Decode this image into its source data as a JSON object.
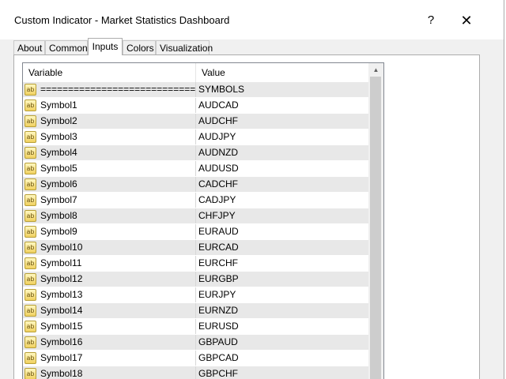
{
  "window": {
    "title": "Custom Indicator - Market Statistics Dashboard",
    "help_label": "?",
    "close_label": "✕"
  },
  "tabs": [
    {
      "label": "About"
    },
    {
      "label": "Common"
    },
    {
      "label": "Inputs",
      "active": true
    },
    {
      "label": "Colors"
    },
    {
      "label": "Visualization"
    }
  ],
  "grid": {
    "headers": {
      "variable": "Variable",
      "value": "Value"
    },
    "row_icon": "ab-string-icon",
    "icon_text": "ab",
    "rows": [
      {
        "variable": "================================",
        "value": "SYMBOLS"
      },
      {
        "variable": "Symbol1",
        "value": "AUDCAD"
      },
      {
        "variable": "Symbol2",
        "value": "AUDCHF"
      },
      {
        "variable": "Symbol3",
        "value": "AUDJPY"
      },
      {
        "variable": "Symbol4",
        "value": "AUDNZD"
      },
      {
        "variable": "Symbol5",
        "value": "AUDUSD"
      },
      {
        "variable": "Symbol6",
        "value": "CADCHF"
      },
      {
        "variable": "Symbol7",
        "value": "CADJPY"
      },
      {
        "variable": "Symbol8",
        "value": "CHFJPY"
      },
      {
        "variable": "Symbol9",
        "value": "EURAUD"
      },
      {
        "variable": "Symbol10",
        "value": "EURCAD"
      },
      {
        "variable": "Symbol11",
        "value": "EURCHF"
      },
      {
        "variable": "Symbol12",
        "value": "EURGBP"
      },
      {
        "variable": "Symbol13",
        "value": "EURJPY"
      },
      {
        "variable": "Symbol14",
        "value": "EURNZD"
      },
      {
        "variable": "Symbol15",
        "value": "EURUSD"
      },
      {
        "variable": "Symbol16",
        "value": "GBPAUD"
      },
      {
        "variable": "Symbol17",
        "value": "GBPCAD"
      },
      {
        "variable": "Symbol18",
        "value": "GBPCHF"
      }
    ]
  },
  "scrollbar": {
    "up_arrow_icon": "chevron-up-icon",
    "up_arrow_glyph": "▲"
  }
}
